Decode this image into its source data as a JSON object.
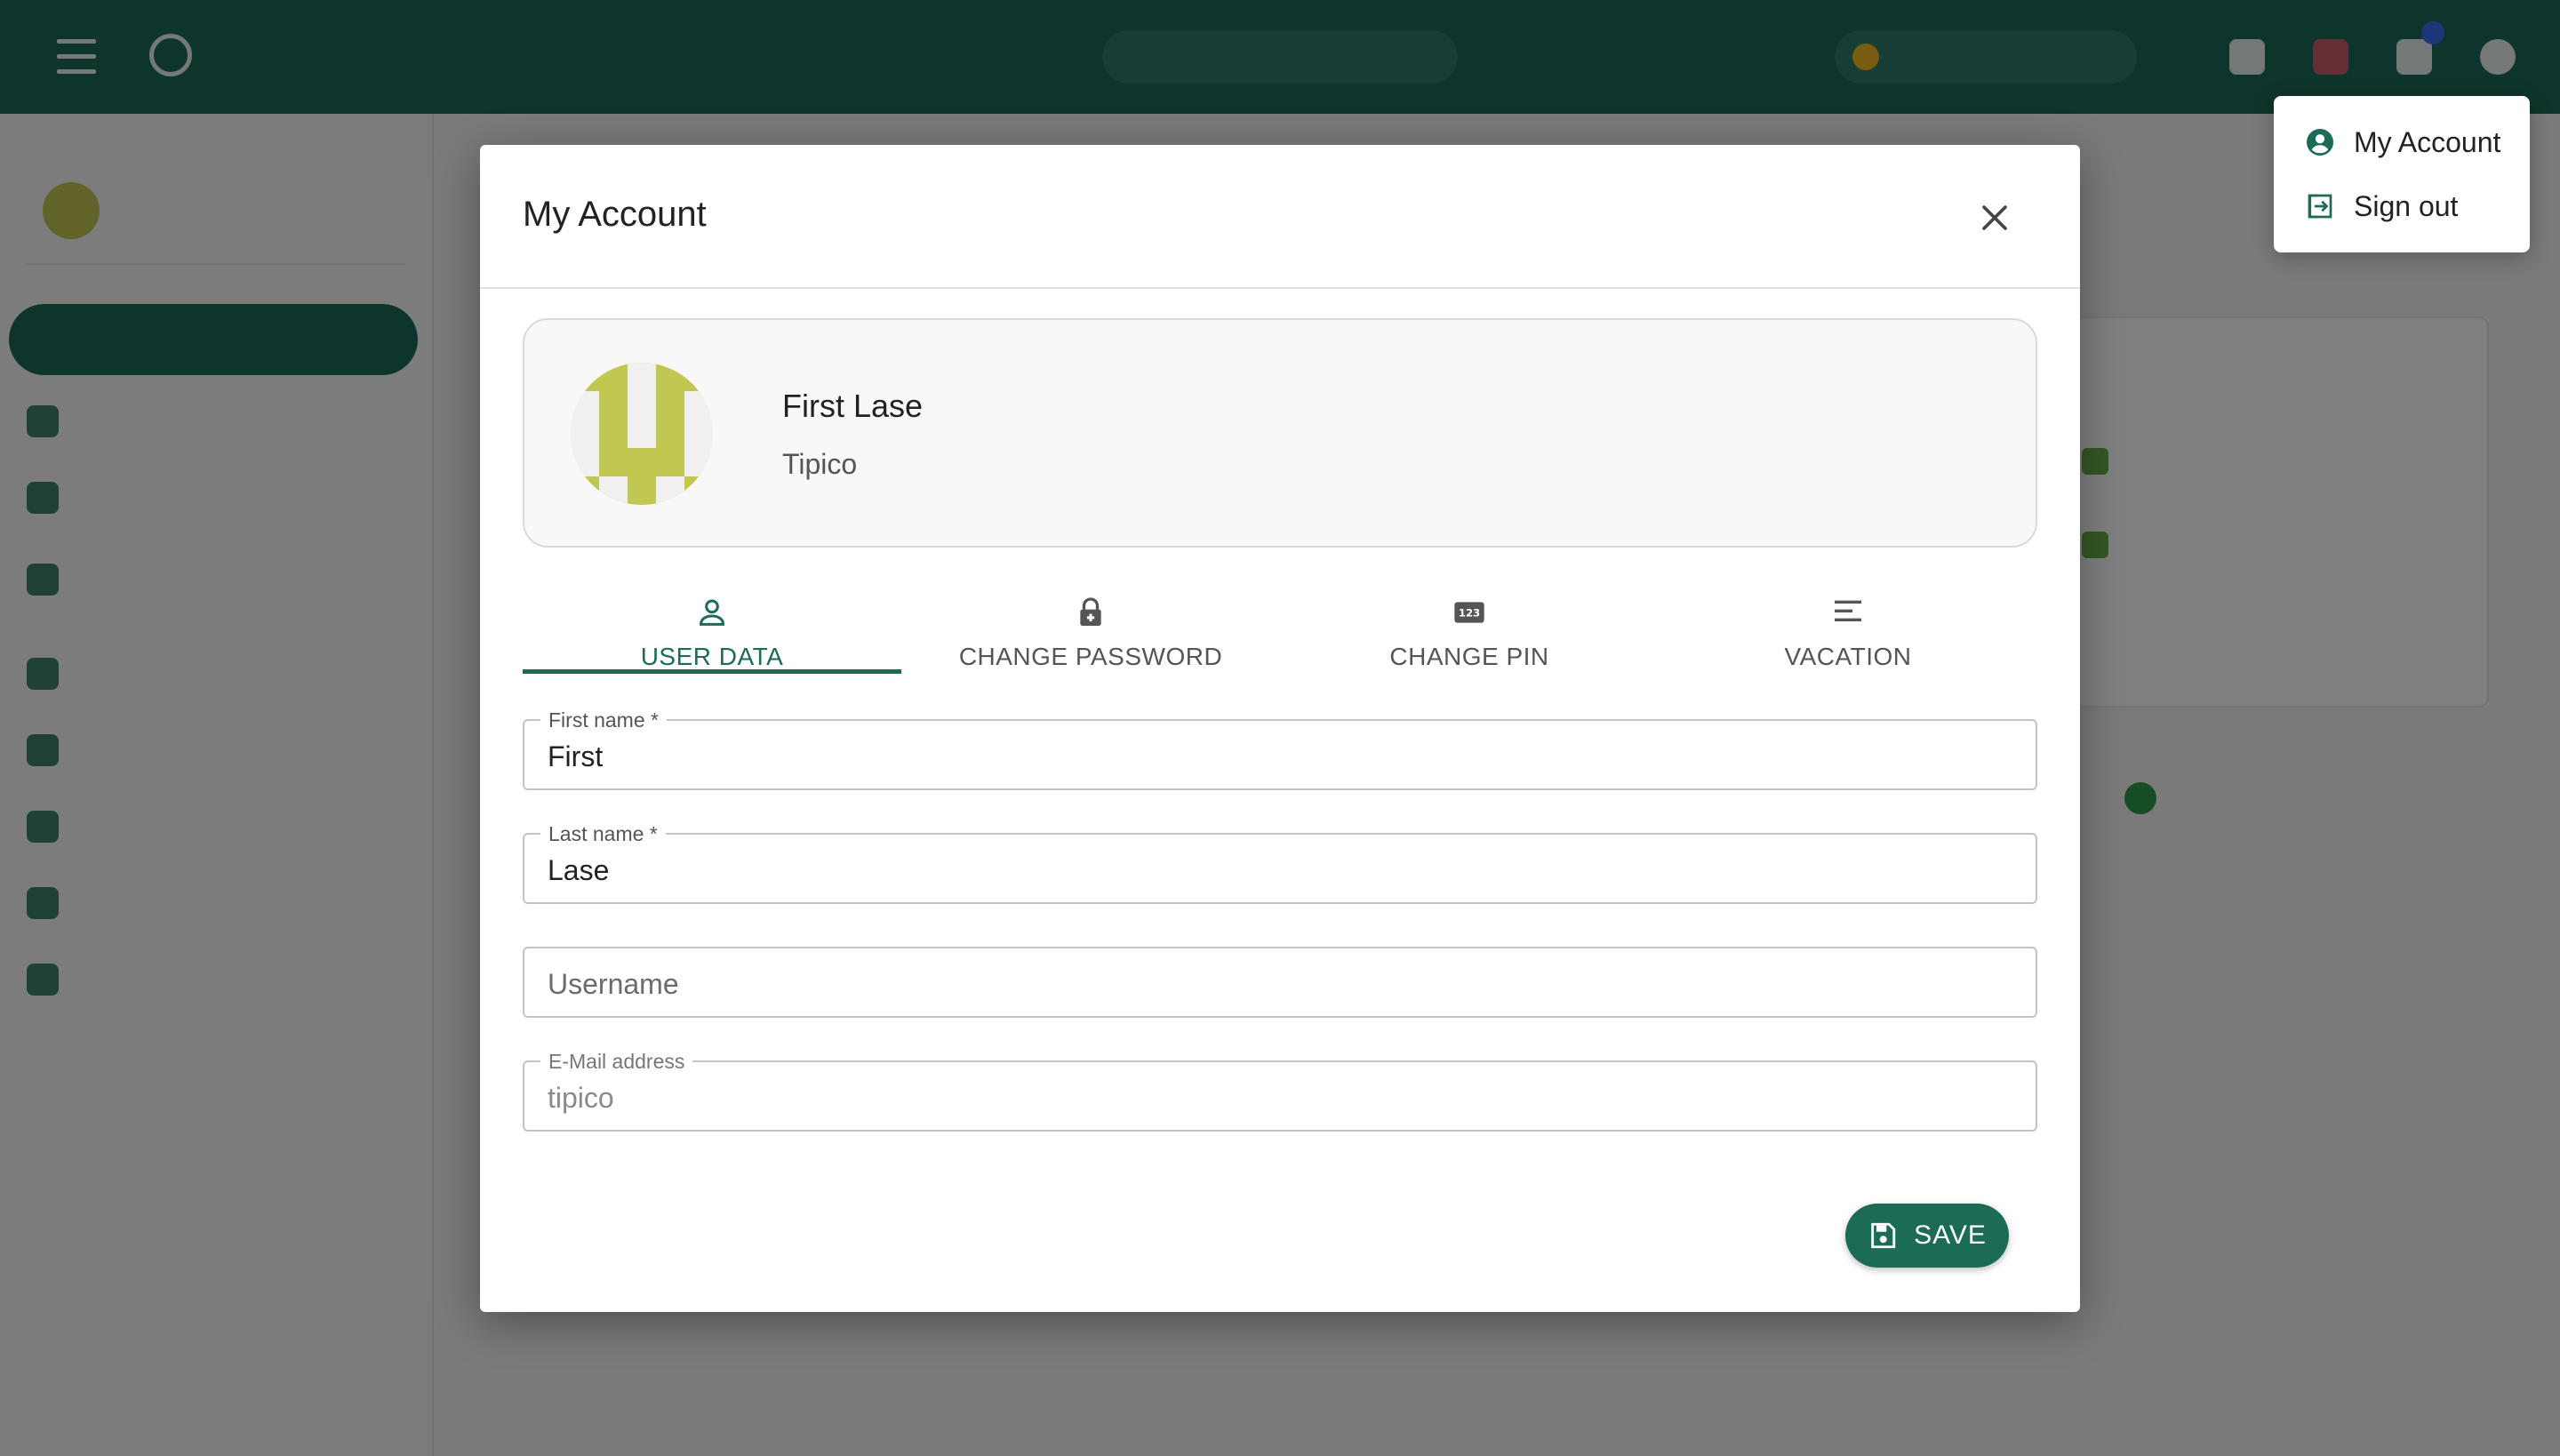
{
  "account_menu": {
    "items": [
      {
        "label": "My Account",
        "icon": "account-circle-icon"
      },
      {
        "label": "Sign out",
        "icon": "sign-out-icon"
      }
    ]
  },
  "modal": {
    "title": "My Account",
    "user": {
      "name": "First Lase",
      "company": "Tipico"
    },
    "tabs": [
      {
        "label": "USER DATA",
        "icon": "person-icon",
        "active": true
      },
      {
        "label": "CHANGE PASSWORD",
        "icon": "lock-icon",
        "active": false
      },
      {
        "label": "CHANGE PIN",
        "icon": "pin-123-icon",
        "active": false
      },
      {
        "label": "VACATION",
        "icon": "lines-icon",
        "active": false
      }
    ],
    "fields": {
      "first_name": {
        "label": "First name *",
        "value": "First"
      },
      "last_name": {
        "label": "Last name *",
        "value": "Lase"
      },
      "username": {
        "placeholder": "Username",
        "value": ""
      },
      "email": {
        "label": "E-Mail address",
        "value": "tipico",
        "disabled": true
      }
    },
    "save_label": "SAVE"
  },
  "colors": {
    "primary": "#1c6b57",
    "avatar": "#c2c751",
    "overlay": "rgba(0,0,0,0.5)"
  }
}
